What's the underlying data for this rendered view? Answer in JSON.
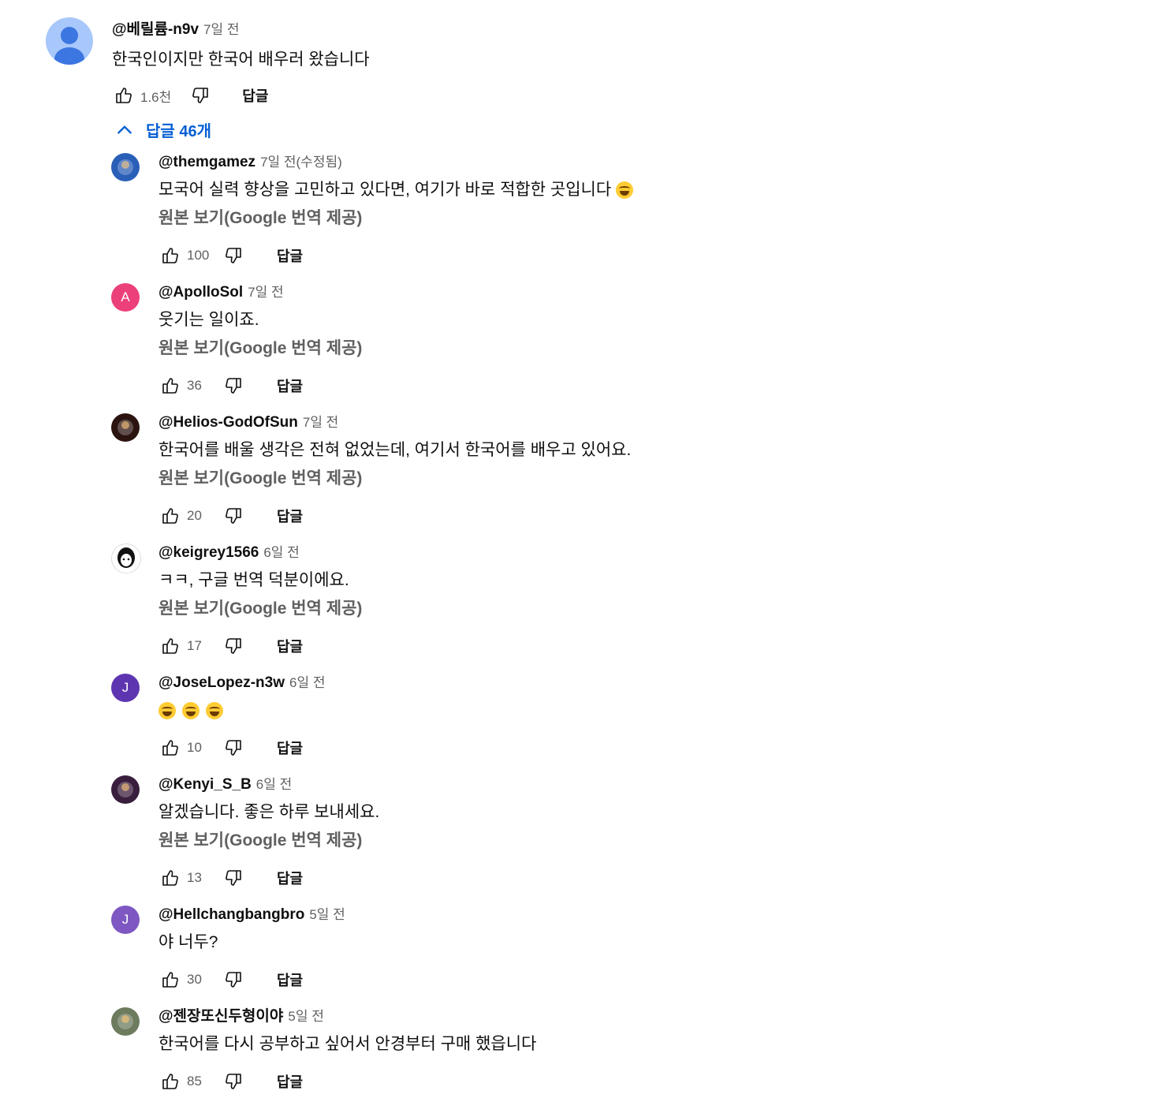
{
  "main_comment": {
    "author": "@베릴륨-n9v",
    "time": "7일 전",
    "text": "한국인이지만 한국어 배우러 왔습니다",
    "likes": "1.6천",
    "reply_label": "답글"
  },
  "replies_toggle": {
    "label": "답글 46개"
  },
  "replies": [
    {
      "author": "@themgamez",
      "time": "7일 전(수정됨)",
      "text": "모국어 실력 향상을 고민하고 있다면, 여기가 바로 적합한 곳입니다",
      "emoji_count": 1,
      "translate": "원본 보기(Google 번역 제공)",
      "likes": "100",
      "reply_label": "답글",
      "avatar_color": "#2a5fb8",
      "avatar_letter": ""
    },
    {
      "author": "@ApolloSol",
      "time": "7일 전",
      "text": "웃기는 일이죠.",
      "emoji_count": 0,
      "translate": "원본 보기(Google 번역 제공)",
      "likes": "36",
      "reply_label": "답글",
      "avatar_color": "#ec407a",
      "avatar_letter": "A"
    },
    {
      "author": "@Helios-GodOfSun",
      "time": "7일 전",
      "text": "한국어를 배울 생각은 전혀 없었는데, 여기서 한국어를 배우고 있어요.",
      "emoji_count": 0,
      "translate": "원본 보기(Google 번역 제공)",
      "likes": "20",
      "reply_label": "답글",
      "avatar_color": "#2b1410",
      "avatar_letter": ""
    },
    {
      "author": "@keigrey1566",
      "time": "6일 전",
      "text": "ㅋㅋ, 구글 번역 덕분이에요.",
      "emoji_count": 0,
      "translate": "원본 보기(Google 번역 제공)",
      "likes": "17",
      "reply_label": "답글",
      "avatar_color": "#ffffff",
      "avatar_letter": ""
    },
    {
      "author": "@JoseLopez-n3w",
      "time": "6일 전",
      "text": "",
      "emoji_count": 3,
      "translate": "",
      "likes": "10",
      "reply_label": "답글",
      "avatar_color": "#5e35b1",
      "avatar_letter": "J"
    },
    {
      "author": "@Kenyi_S_B",
      "time": "6일 전",
      "text": "알겠습니다. 좋은 하루 보내세요.",
      "emoji_count": 0,
      "translate": "원본 보기(Google 번역 제공)",
      "likes": "13",
      "reply_label": "답글",
      "avatar_color": "#3a1e3e",
      "avatar_letter": ""
    },
    {
      "author": "@Hellchangbangbro",
      "time": "5일 전",
      "text": "야 너두?",
      "emoji_count": 0,
      "translate": "",
      "likes": "30",
      "reply_label": "답글",
      "avatar_color": "#7e57c2",
      "avatar_letter": "J"
    },
    {
      "author": "@젠장또신두형이야",
      "time": "5일 전",
      "text": "한국어를 다시 공부하고 싶어서 안경부터 구매 했읍니다",
      "emoji_count": 0,
      "translate": "",
      "likes": "85",
      "reply_label": "답글",
      "avatar_color": "#6d7b5e",
      "avatar_letter": ""
    }
  ]
}
